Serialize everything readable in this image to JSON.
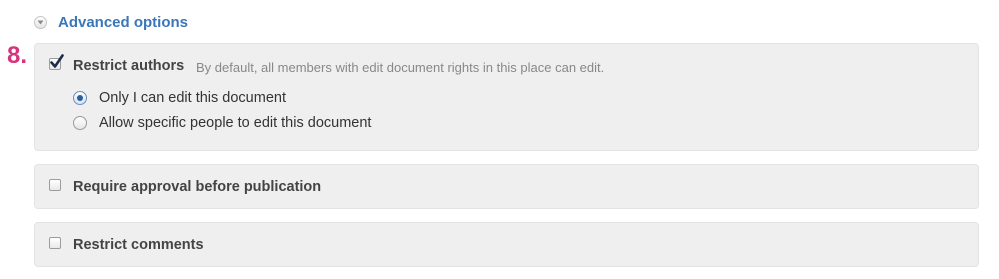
{
  "advanced_options": {
    "label": "Advanced options",
    "icon": "chevron-down-circle-icon",
    "accent_color": "#3a77b9"
  },
  "step_number": "8.",
  "step_color": "#d6337a",
  "options": {
    "restrict_authors": {
      "label": "Restrict authors",
      "description": "By default, all members with edit document rights in this place can edit.",
      "checked": true,
      "radio_options": [
        {
          "label": "Only I can edit this document",
          "selected": true
        },
        {
          "label": "Allow specific people to edit this document",
          "selected": false
        }
      ]
    },
    "require_approval": {
      "label": "Require approval before publication",
      "checked": false
    },
    "restrict_comments": {
      "label": "Restrict comments",
      "checked": false
    }
  }
}
